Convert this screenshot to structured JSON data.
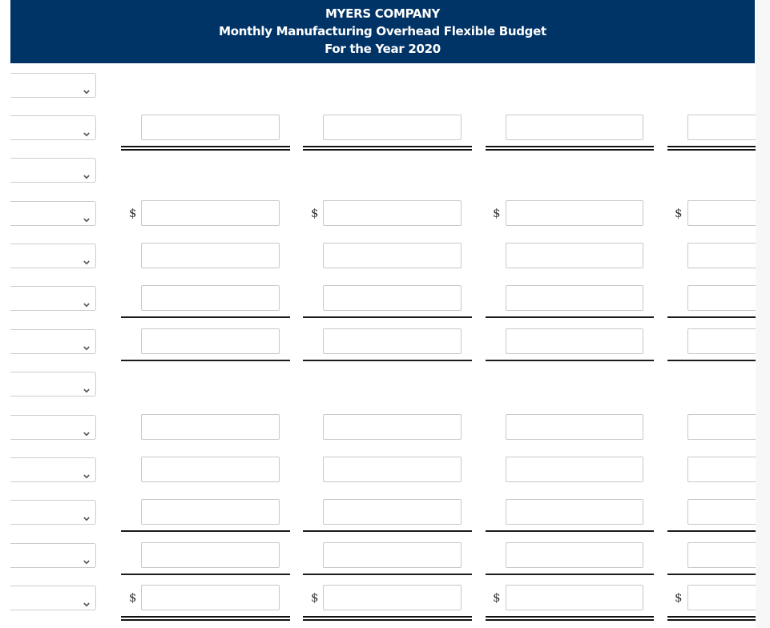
{
  "header": {
    "company": "MYERS COMPANY",
    "title": "Monthly Manufacturing Overhead Flexible Budget",
    "period": "For the Year 2020"
  },
  "currency_symbol": "$",
  "colors": {
    "header_bg": "#003366",
    "header_text": "#ffffff",
    "input_border": "#c8c8c8"
  },
  "rows": [
    {
      "label_select": "",
      "inputs": false,
      "dollar": false,
      "rule_below": "none"
    },
    {
      "label_select": "",
      "inputs": true,
      "values": [
        "",
        "",
        "",
        ""
      ],
      "dollar": false,
      "rule_below": "double"
    },
    {
      "label_select": "",
      "inputs": false,
      "dollar": false,
      "rule_below": "none"
    },
    {
      "label_select": "",
      "inputs": true,
      "values": [
        "",
        "",
        "",
        ""
      ],
      "dollar": true,
      "rule_below": "none"
    },
    {
      "label_select": "",
      "inputs": true,
      "values": [
        "",
        "",
        "",
        ""
      ],
      "dollar": false,
      "rule_below": "none"
    },
    {
      "label_select": "",
      "inputs": true,
      "values": [
        "",
        "",
        "",
        ""
      ],
      "dollar": false,
      "rule_below": "single"
    },
    {
      "label_select": "",
      "inputs": true,
      "values": [
        "",
        "",
        "",
        ""
      ],
      "dollar": false,
      "rule_below": "single"
    },
    {
      "label_select": "",
      "inputs": false,
      "dollar": false,
      "rule_below": "none"
    },
    {
      "label_select": "",
      "inputs": true,
      "values": [
        "",
        "",
        "",
        ""
      ],
      "dollar": false,
      "rule_below": "none"
    },
    {
      "label_select": "",
      "inputs": true,
      "values": [
        "",
        "",
        "",
        ""
      ],
      "dollar": false,
      "rule_below": "none"
    },
    {
      "label_select": "",
      "inputs": true,
      "values": [
        "",
        "",
        "",
        ""
      ],
      "dollar": false,
      "rule_below": "single"
    },
    {
      "label_select": "",
      "inputs": true,
      "values": [
        "",
        "",
        "",
        ""
      ],
      "dollar": false,
      "rule_below": "single"
    },
    {
      "label_select": "",
      "inputs": true,
      "values": [
        "",
        "",
        "",
        ""
      ],
      "dollar": true,
      "rule_below": "double"
    }
  ]
}
